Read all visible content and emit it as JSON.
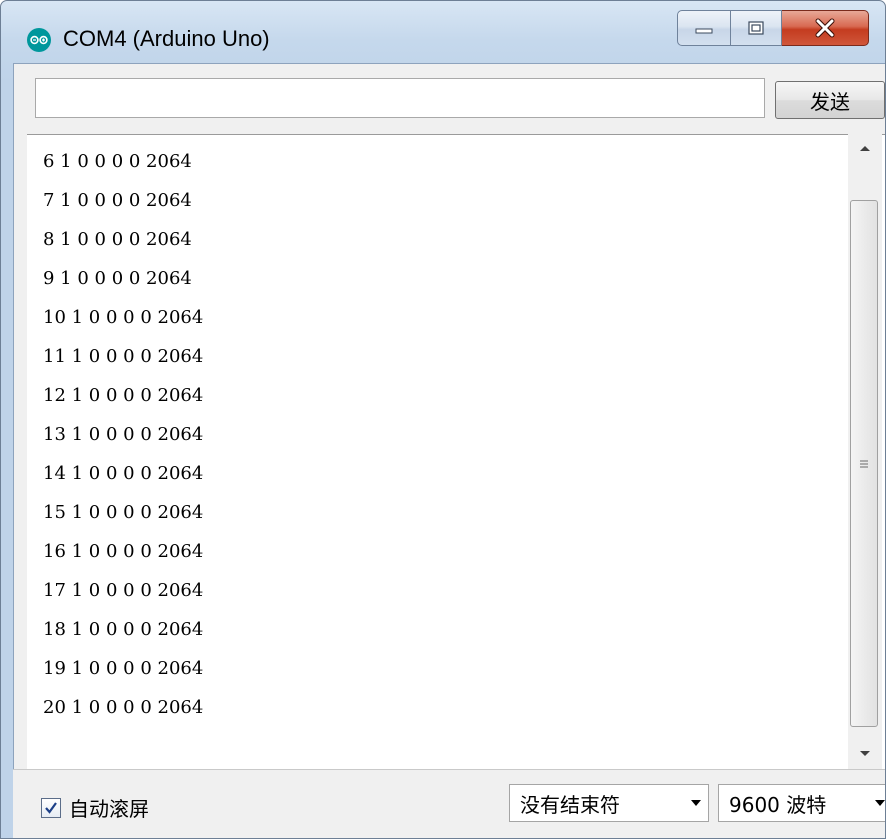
{
  "window": {
    "title": "COM4 (Arduino Uno)",
    "icon": "arduino-logo-icon",
    "buttons": {
      "minimize": "minimize-icon",
      "maximize": "maximize-icon",
      "close": "close-icon"
    }
  },
  "send_bar": {
    "input_value": "",
    "send_label": "发送"
  },
  "serial_output": {
    "lines": [
      "6 1 0 0 0 0 2064",
      "7 1 0 0 0 0 2064",
      "8 1 0 0 0 0 2064",
      "9 1 0 0 0 0 2064",
      "10 1 0 0 0 0 2064",
      "11 1 0 0 0 0 2064",
      "12 1 0 0 0 0 2064",
      "13 1 0 0 0 0 2064",
      "14 1 0 0 0 0 2064",
      "15 1 0 0 0 0 2064",
      "16 1 0 0 0 0 2064",
      "17 1 0 0 0 0 2064",
      "18 1 0 0 0 0 2064",
      "19 1 0 0 0 0 2064",
      "20 1 0 0 0 0 2064"
    ]
  },
  "bottom_bar": {
    "autoscroll_label": "自动滚屏",
    "autoscroll_checked": true,
    "line_ending": "没有结束符",
    "baud_rate": "9600 波特"
  },
  "colors": {
    "arduino_teal": "#00979c",
    "close_red": "#c43c20",
    "title_bar": "#c5d8ec"
  }
}
